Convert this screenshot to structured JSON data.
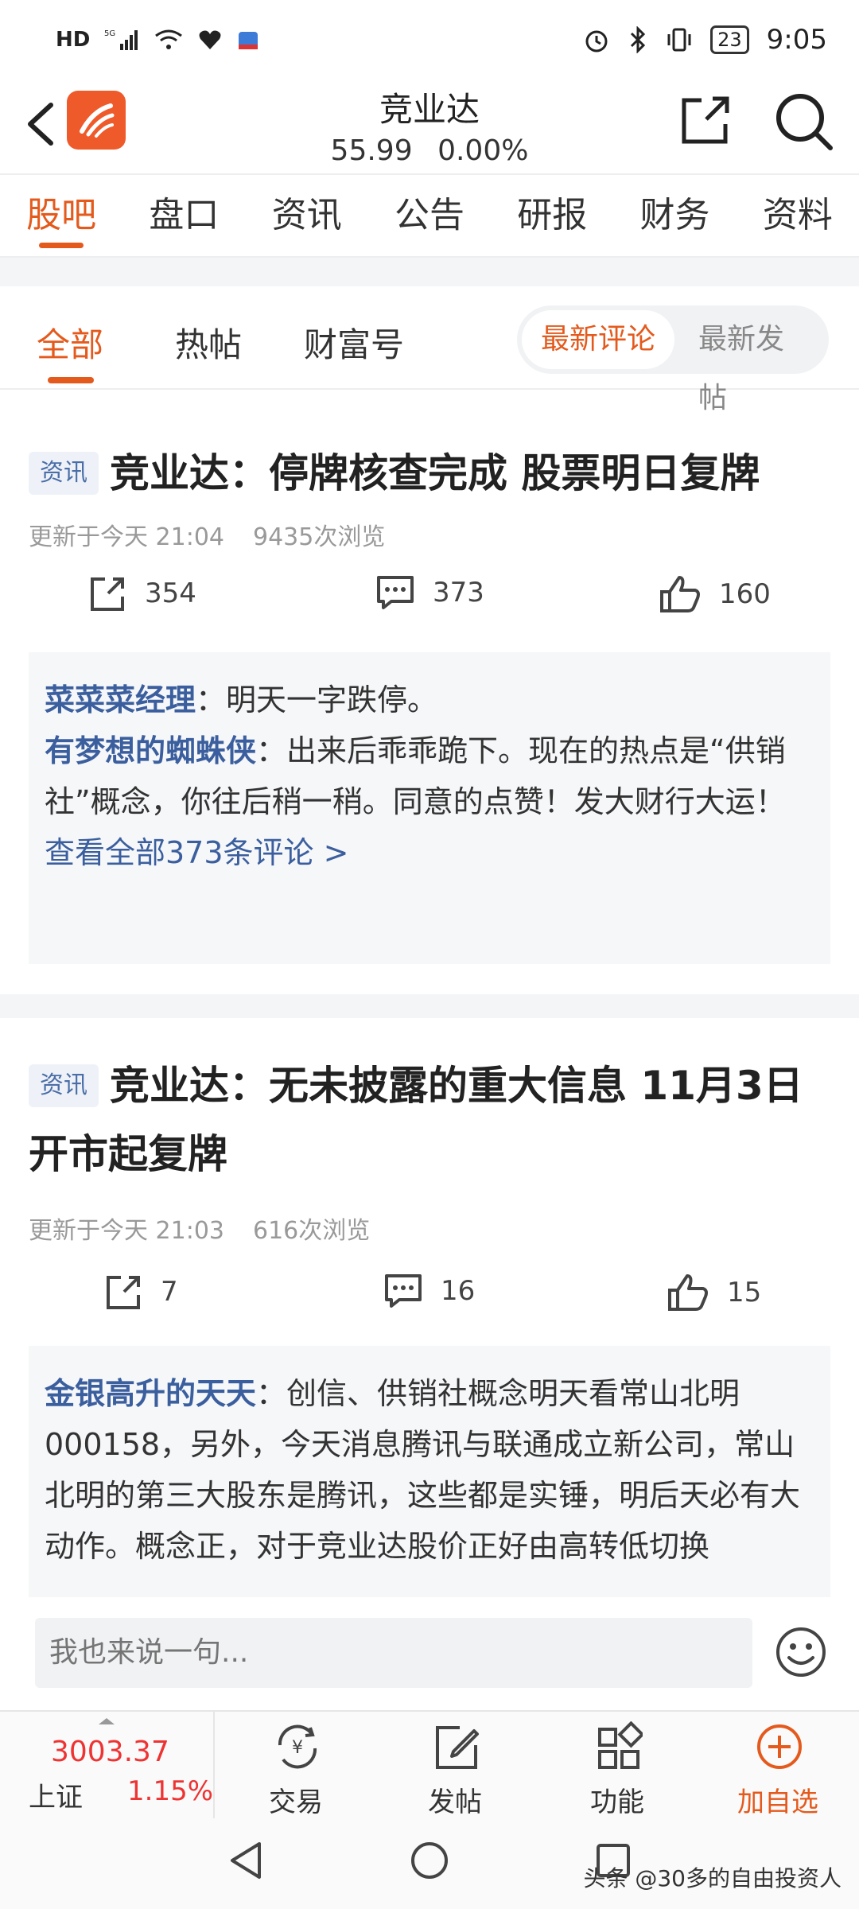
{
  "status": {
    "left_icons": [
      "HD",
      "5G signal",
      "6 wifi",
      "heart",
      "app"
    ],
    "battery": "23",
    "time": "9:05"
  },
  "header": {
    "title": "竞业达",
    "price": "55.99",
    "change": "0.00%"
  },
  "main_tabs": [
    "股吧",
    "盘口",
    "资讯",
    "公告",
    "研报",
    "财务",
    "资料"
  ],
  "sub_tabs": [
    "全部",
    "热帖",
    "财富号"
  ],
  "sort_toggle": {
    "active": "最新评论",
    "inactive": "最新发帖"
  },
  "posts": [
    {
      "tag": "资讯",
      "title": "竞业达：停牌核查完成 股票明日复牌",
      "updated": "更新于今天 21:04",
      "views": "9435次浏览",
      "shares": "354",
      "comments": "373",
      "likes": "160",
      "comment_list": [
        {
          "user": "菜菜菜经理",
          "text": "：明天一字跌停。"
        },
        {
          "user": "有梦想的蜘蛛侠",
          "text": "：出来后乖乖跪下。现在的热点是“供销社”概念，你往后稍一稍。同意的点赞！发大财行大运！"
        }
      ],
      "more": "查看全部373条评论 >"
    },
    {
      "tag": "资讯",
      "title": "竞业达：无未披露的重大信息 11月3日开市起复牌",
      "updated": "更新于今天 21:03",
      "views": "616次浏览",
      "shares": "7",
      "comments": "16",
      "likes": "15",
      "comment_list": [
        {
          "user": "金银高升的天天",
          "text": "：创信、供销社概念明天看常山北明000158，另外，今天消息腾讯与联通成立新公司，常山北明的第三大股东是腾讯，这些都是实锤，明后天必有大动作。概念正，对于竞业达股价正好由高转低切换"
        }
      ]
    }
  ],
  "composer": {
    "placeholder": "我也来说一句..."
  },
  "bottom_nav": {
    "index_value": "3003.37",
    "index_name": "上证",
    "index_pct": "1.15%",
    "items": [
      "交易",
      "发帖",
      "功能",
      "加自选"
    ]
  },
  "watermark": "头条 @30多的自由投资人",
  "colors": {
    "accent": "#e45a1d",
    "link": "#3b5f9e",
    "up": "#e33333"
  }
}
